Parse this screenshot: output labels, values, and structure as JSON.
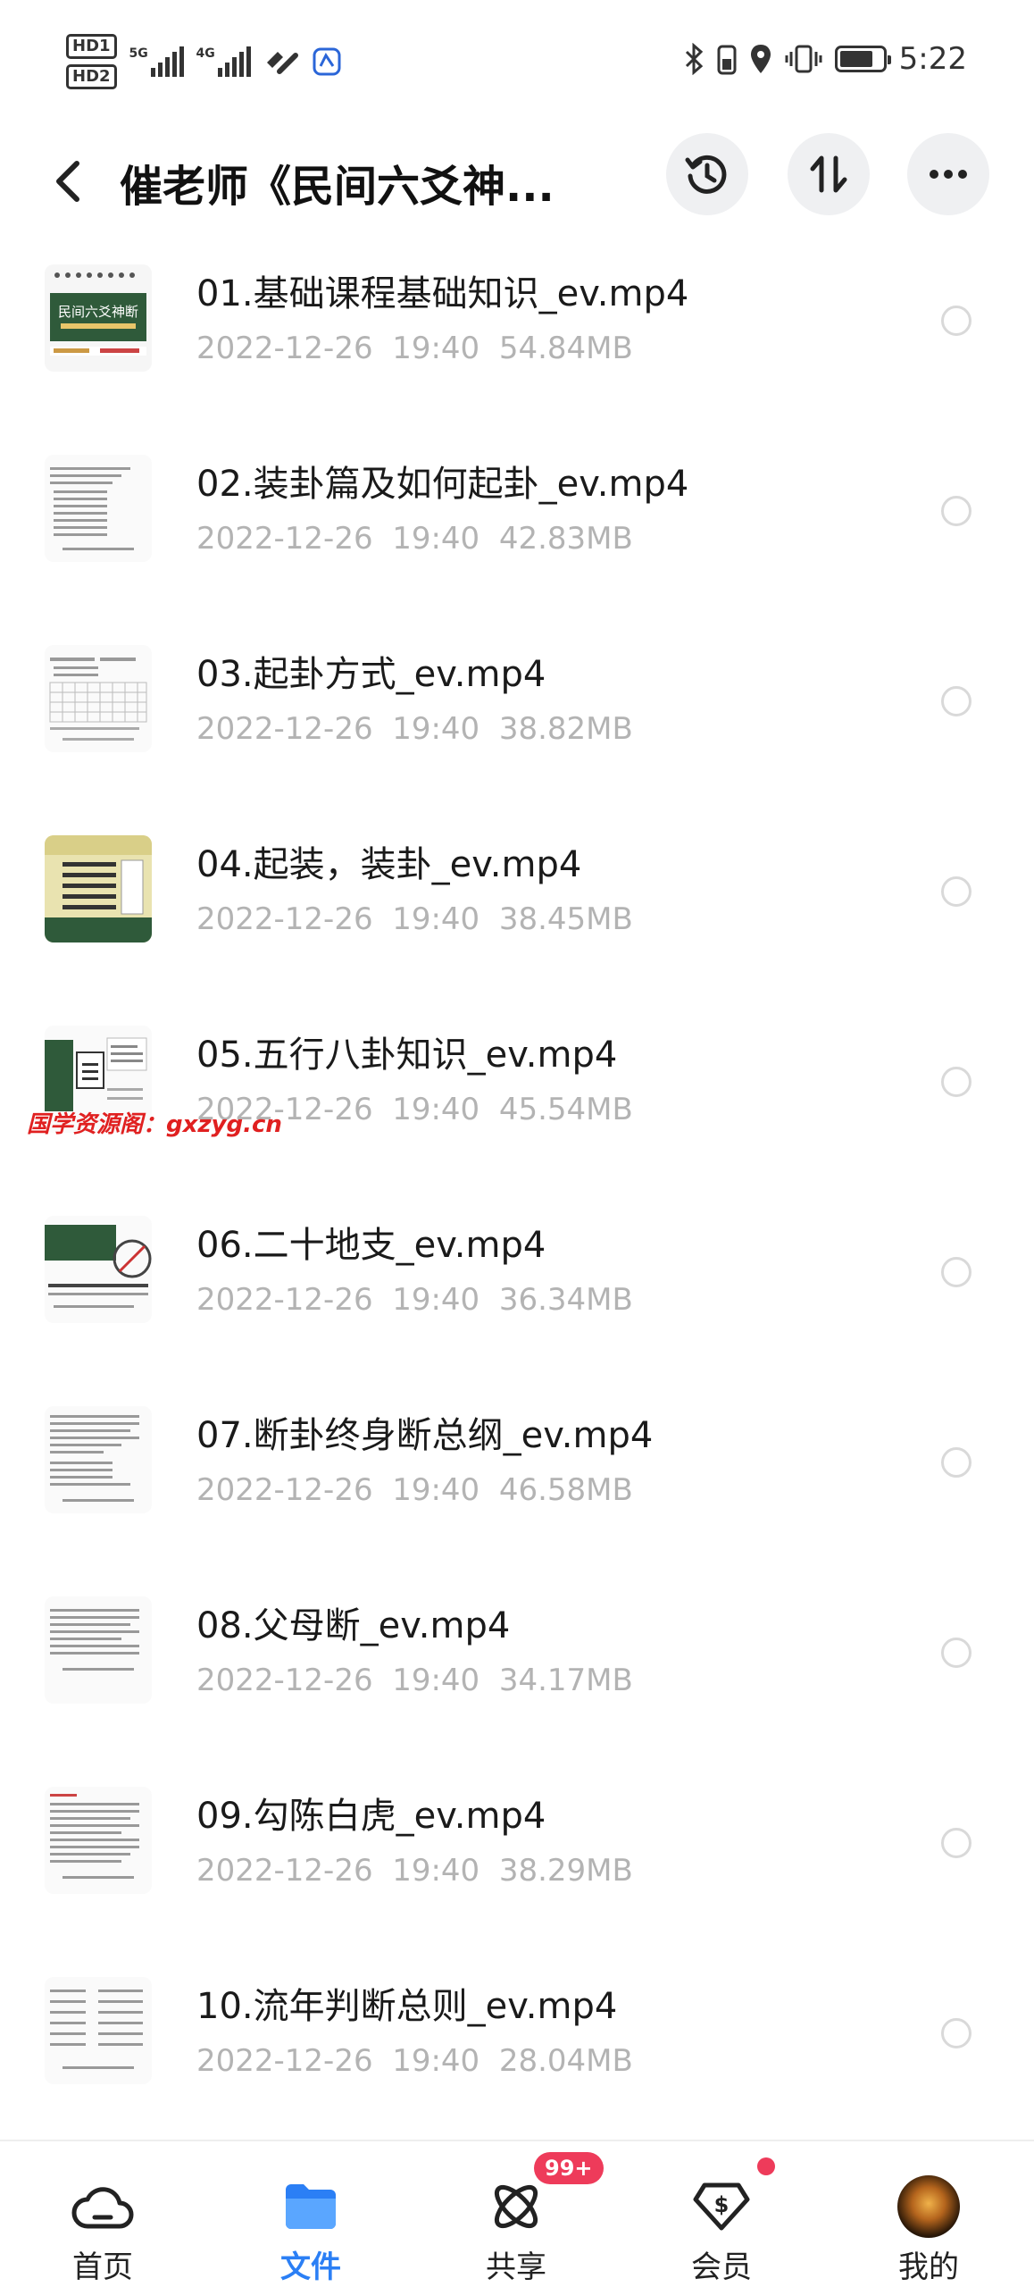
{
  "status_bar": {
    "sim1": "HD1",
    "sim2": "HD2",
    "net1": "5G",
    "net2": "4G",
    "time": "5:22"
  },
  "header": {
    "title": "催老师《民间六爻神...",
    "icons": [
      "back-icon",
      "history-icon",
      "sort-icon",
      "more-icon"
    ]
  },
  "files": [
    {
      "name": "01.基础课程基础知识_ev.mp4",
      "date": "2022-12-26  19:40",
      "size": "54.84MB"
    },
    {
      "name": "02.装卦篇及如何起卦_ev.mp4",
      "date": "2022-12-26  19:40",
      "size": "42.83MB"
    },
    {
      "name": "03.起卦方式_ev.mp4",
      "date": "2022-12-26  19:40",
      "size": "38.82MB"
    },
    {
      "name": "04.起装，装卦_ev.mp4",
      "date": "2022-12-26  19:40",
      "size": "38.45MB"
    },
    {
      "name": "05.五行八卦知识_ev.mp4",
      "date": "2022-12-26  19:40",
      "size": "45.54MB"
    },
    {
      "name": "06.二十地支_ev.mp4",
      "date": "2022-12-26  19:40",
      "size": "36.34MB"
    },
    {
      "name": "07.断卦终身断总纲_ev.mp4",
      "date": "2022-12-26  19:40",
      "size": "46.58MB"
    },
    {
      "name": "08.父母断_ev.mp4",
      "date": "2022-12-26  19:40",
      "size": "34.17MB"
    },
    {
      "name": "09.勾陈白虎_ev.mp4",
      "date": "2022-12-26  19:40",
      "size": "38.29MB"
    },
    {
      "name": "10.流年判断总则_ev.mp4",
      "date": "2022-12-26  19:40",
      "size": "28.04MB"
    }
  ],
  "watermark": "国学资源阁：gxzyg.cn",
  "thumb1_text": "民间六爻神断",
  "tabbar": {
    "tabs": [
      {
        "label": "首页",
        "icon": "cloud-home-icon"
      },
      {
        "label": "文件",
        "icon": "folder-icon",
        "active": true
      },
      {
        "label": "共享",
        "icon": "share-atom-icon",
        "badge": "99+"
      },
      {
        "label": "会员",
        "icon": "vip-s-icon",
        "dot": true
      },
      {
        "label": "我的",
        "icon": "avatar"
      }
    ]
  },
  "colors": {
    "accent": "#2b7ff5",
    "badge": "#ee3b5a",
    "meta_text": "#b3b3b3",
    "watermark": "#e02020"
  }
}
